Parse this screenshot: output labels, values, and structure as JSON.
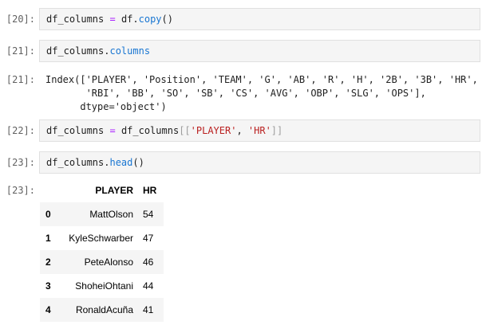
{
  "cells": [
    {
      "prompt": "[20]:",
      "code": {
        "var": "df_columns",
        "op": " = ",
        "obj": "df",
        "dot": ".",
        "method": "copy",
        "args": "()"
      }
    },
    {
      "prompt": "[21]:",
      "code": {
        "var": "df_columns",
        "dot": ".",
        "attr": "columns"
      }
    },
    {
      "prompt": "[22]:",
      "code": {
        "var": "df_columns",
        "op": " = ",
        "obj": "df_columns",
        "open": "[[",
        "s1": "'PLAYER'",
        "comma": ", ",
        "s2": "'HR'",
        "close": "]]"
      }
    },
    {
      "prompt": "[23]:",
      "code": {
        "var": "df_columns",
        "dot": ".",
        "method": "head",
        "args": "()"
      }
    }
  ],
  "output_21": {
    "prompt": "[21]:",
    "line1": "Index(['PLAYER', 'Position', 'TEAM', 'G', 'AB', 'R', 'H', '2B', '3B', 'HR',",
    "line2": "       'RBI', 'BB', 'SO', 'SB', 'CS', 'AVG', 'OBP', 'SLG', 'OPS'],",
    "line3": "      dtype='object')"
  },
  "output_23": {
    "prompt": "[23]:",
    "columns": [
      "PLAYER",
      "HR"
    ],
    "rows": [
      {
        "index": "0",
        "player": "MattOlson",
        "hr": "54"
      },
      {
        "index": "1",
        "player": "KyleSchwarber",
        "hr": "47"
      },
      {
        "index": "2",
        "player": "PeteAlonso",
        "hr": "46"
      },
      {
        "index": "3",
        "player": "ShoheiOhtani",
        "hr": "44"
      },
      {
        "index": "4",
        "player": "RonaldAcuña",
        "hr": "41"
      }
    ]
  }
}
